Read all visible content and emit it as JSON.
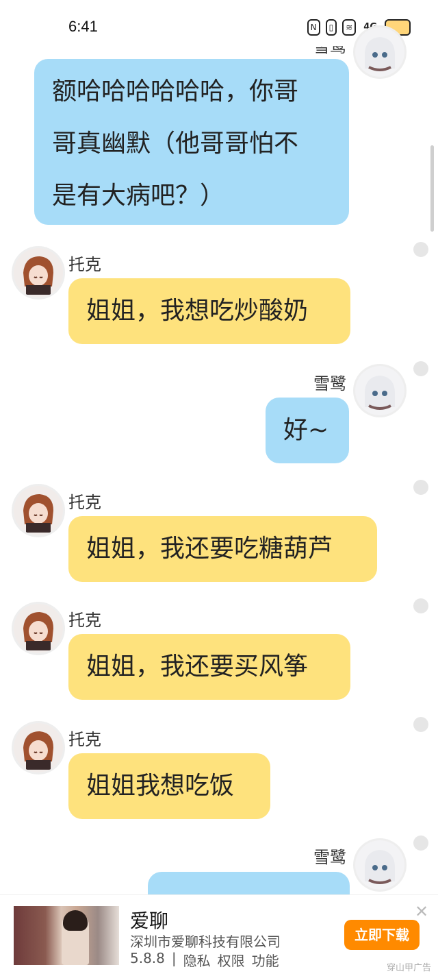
{
  "status_bar": {
    "time": "6:41",
    "icons": [
      "nfc-icon",
      "vibrate-icon",
      "wifi-icon",
      "signal-4g-icon",
      "battery-icon"
    ],
    "network_label": "4G"
  },
  "partial_top_sender": "雪鹭",
  "messages": [
    {
      "sender": "雪鹭",
      "text_lines": [
        "额哈哈哈哈哈哈，你哥",
        "哥真幽默（他哥哥怕不",
        "是有大病吧？）"
      ],
      "side": "right"
    },
    {
      "sender": "托克",
      "text": "姐姐，我想吃炒酸奶",
      "side": "left"
    },
    {
      "sender": "雪鹭",
      "text": "好~",
      "side": "right"
    },
    {
      "sender": "托克",
      "text": "姐姐，我还要吃糖葫芦",
      "side": "left"
    },
    {
      "sender": "托克",
      "text": "姐姐，我还要买风筝",
      "side": "left"
    },
    {
      "sender": "托克",
      "text": "姐姐我想吃饭",
      "side": "left"
    },
    {
      "sender": "雪鹭",
      "text": "",
      "side": "right"
    }
  ],
  "ad": {
    "title": "爱聊",
    "company": "深圳市爱聊科技有限公司",
    "version": "5.8.8",
    "separator": "|",
    "links": [
      "隐私",
      "权限",
      "功能"
    ],
    "cta": "立即下载",
    "close_glyph": "✕",
    "tag": "穿山甲广告"
  },
  "colors": {
    "self_bubble": "#a7dcf8",
    "other_bubble": "#fee27d",
    "cta": "#ff8a00"
  }
}
